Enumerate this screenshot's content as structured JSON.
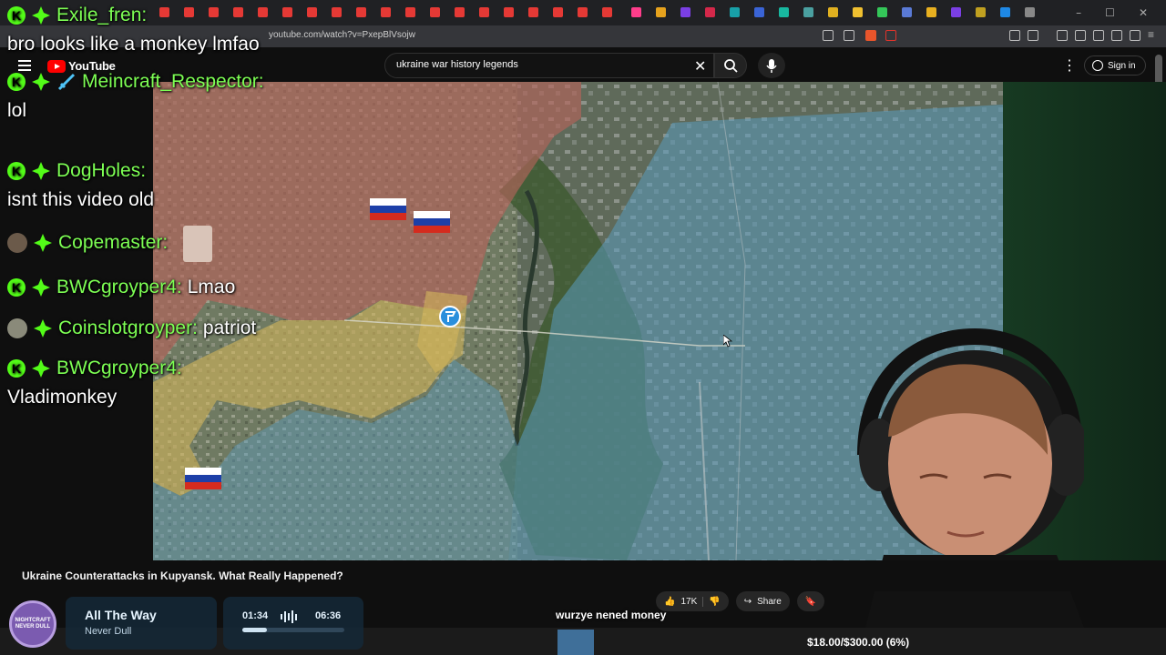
{
  "browser": {
    "url": "youtube.com/watch?v=PxepBlVsojw",
    "window_controls": [
      "–",
      "☐",
      "✕"
    ]
  },
  "youtube": {
    "logo_text": "YouTube",
    "search_value": "ukraine war history legends",
    "sign_in_label": "Sign in"
  },
  "chat": [
    {
      "user": "Exile_fren:",
      "message": "bro looks like a monkey lmfao",
      "badges": [
        "kick",
        "sub"
      ],
      "wrap": true
    },
    {
      "user": "Meincraft_Respector:",
      "message": "lol",
      "badges": [
        "kick",
        "sub",
        "sword"
      ],
      "wrap": true
    },
    {
      "user": "DogHoles:",
      "message": "isnt this video old",
      "badges": [
        "kick",
        "sub"
      ],
      "wrap": true
    },
    {
      "user": "Copemaster:",
      "message": "",
      "badges": [
        "avatar",
        "sub"
      ],
      "wrap": false
    },
    {
      "user": "BWCgroyper4:",
      "message": "Lmao",
      "badges": [
        "kick",
        "sub"
      ],
      "wrap": false
    },
    {
      "user": "Coinslotgroyper:",
      "message": "patriot",
      "badges": [
        "avatar",
        "sub"
      ],
      "wrap": false
    },
    {
      "user": "BWCgroyper4:",
      "message": "Vladimonkey",
      "badges": [
        "kick",
        "sub"
      ],
      "wrap": true
    }
  ],
  "video": {
    "title": "Ukraine Counterattacks in Kupyansk. What Really Happened?",
    "likes": "17K",
    "share_label": "Share"
  },
  "music": {
    "disc_label": "NIGHTCRAFT NEVER DULL",
    "title": "All The Way",
    "artist": "Never Dull",
    "current_time": "01:34",
    "total_time": "06:36",
    "progress": 0.24
  },
  "overlay": {
    "caption": "wurzye nened money",
    "donation_goal": "$18.00/$300.00 (6%)"
  },
  "colors": {
    "chat_username": "#7dff54",
    "kick_green": "#53fc18",
    "russian_zone": "#b4645a",
    "contested_zone": "#d2b45a",
    "ukraine_zone": "#5a9bbe"
  }
}
